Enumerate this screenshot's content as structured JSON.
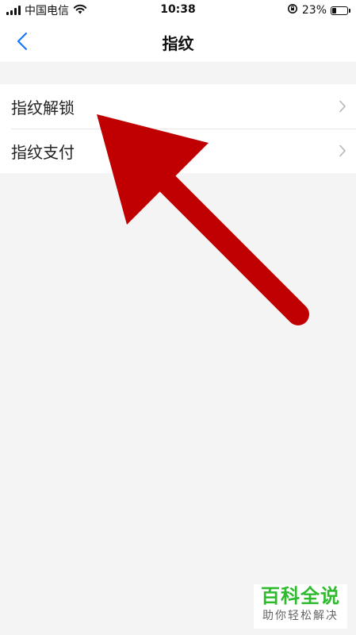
{
  "status_bar": {
    "carrier": "中国电信",
    "time": "10:38",
    "battery": "23%",
    "battery_level": 0.23,
    "icons": [
      "signal-icon",
      "wifi-icon",
      "rotation-lock-icon",
      "battery-icon"
    ]
  },
  "nav": {
    "title": "指纹",
    "back_icon": "chevron-left-icon"
  },
  "list": {
    "items": [
      {
        "label": "指纹解锁",
        "icon": "chevron-right-icon"
      },
      {
        "label": "指纹支付",
        "icon": "chevron-right-icon"
      }
    ]
  },
  "overlay": {
    "arrow_color": "#c00000"
  },
  "watermark": {
    "title": "百科全说",
    "subtitle": "助你轻松解决"
  },
  "colors": {
    "accent": "#1677ff",
    "background": "#f4f4f4",
    "watermark_green": "#2dbb2d"
  }
}
